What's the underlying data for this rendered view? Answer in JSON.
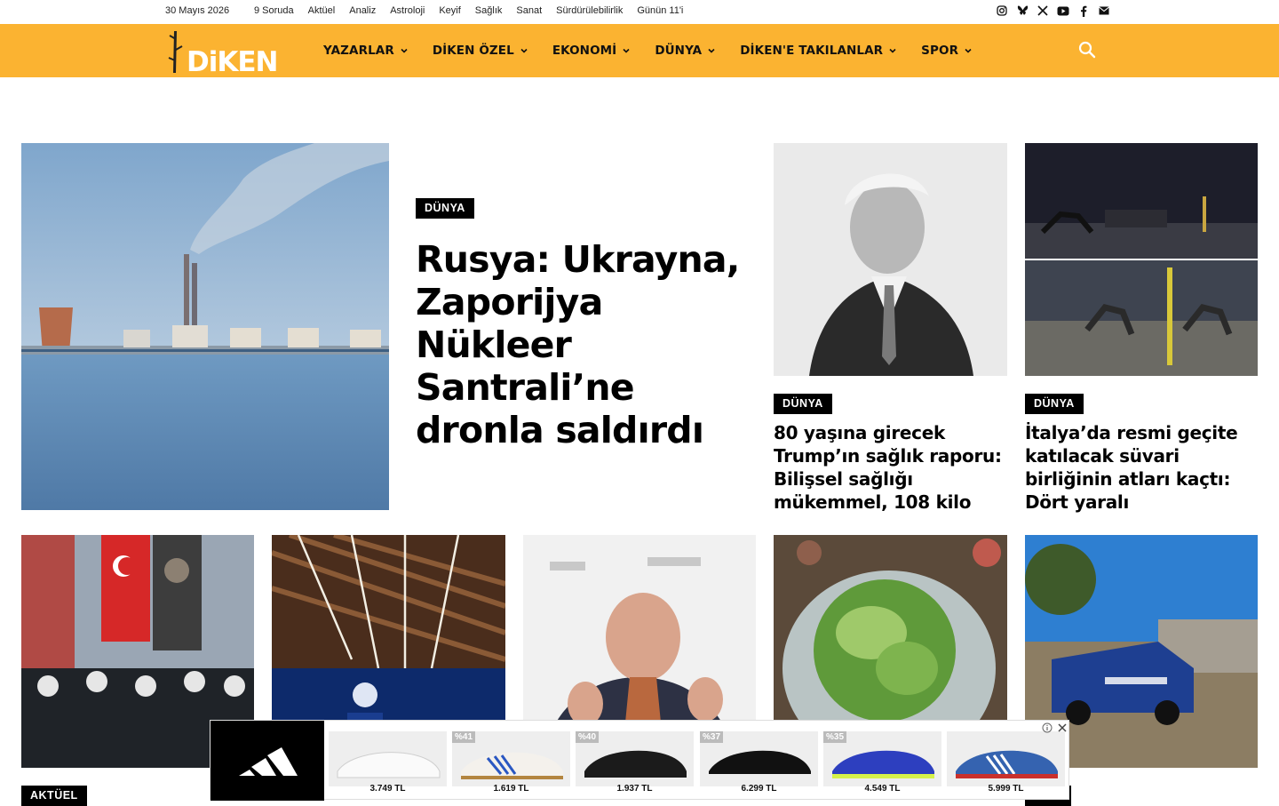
{
  "topbar": {
    "date": "30 Mayıs 2026",
    "links": [
      "9 Soruda",
      "Aktüel",
      "Analiz",
      "Astroloji",
      "Keyif",
      "Sağlık",
      "Sanat",
      "Sürdürülebilirlik",
      "Günün 11'i"
    ],
    "socials": [
      "instagram-icon",
      "bluesky-icon",
      "x-icon",
      "youtube-icon",
      "facebook-icon",
      "mail-icon"
    ]
  },
  "header": {
    "logo_text": "DiKEN",
    "nav": [
      "YAZARLAR",
      "DİKEN ÖZEL",
      "EKONOMİ",
      "DÜNYA",
      "DİKEN'E TAKILANLAR",
      "SPOR"
    ],
    "accent_color": "#fbb331"
  },
  "hero": {
    "category": "DÜNYA",
    "title": "Rusya: Ukrayna, Zaporijya Nükleer Santrali’ne dronla saldırdı"
  },
  "side_stories": [
    {
      "category": "DÜNYA",
      "title": "80 yaşına girecek Trump’ın sağlık raporu: Bilişsel sağlığı mükemmel, 108 kilo"
    },
    {
      "category": "DÜNYA",
      "title": "İtalya’da resmi geçite katılacak süvari birliğinin atları kaçtı: Dört yaralı"
    }
  ],
  "bottom_row": {
    "first_category": "AKTÜEL"
  },
  "ad": {
    "products": [
      {
        "discount": "",
        "price": "3.749 TL"
      },
      {
        "discount": "%41",
        "price": "1.619 TL"
      },
      {
        "discount": "%40",
        "price": "1.937 TL"
      },
      {
        "discount": "%37",
        "price": "6.299 TL"
      },
      {
        "discount": "%35",
        "price": "4.549 TL"
      },
      {
        "discount": "",
        "price": "5.999 TL"
      }
    ]
  }
}
